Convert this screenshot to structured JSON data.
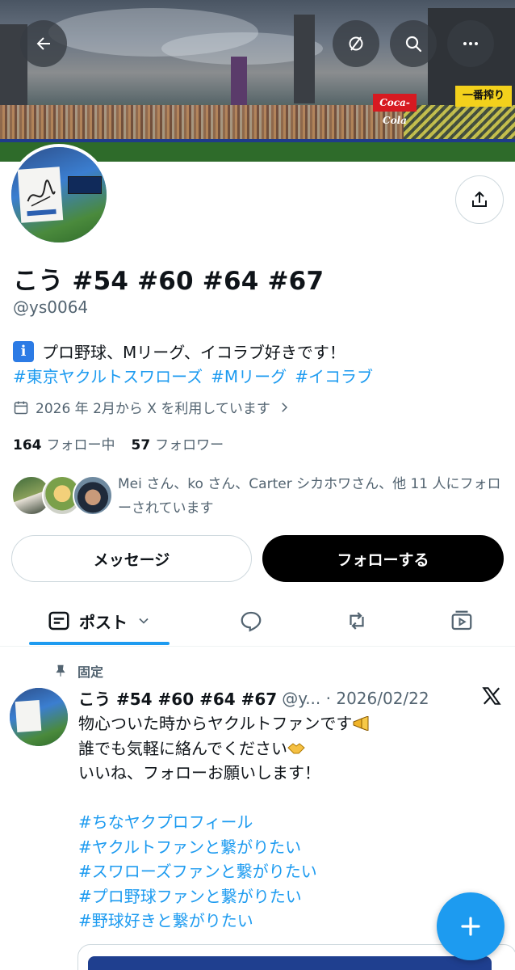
{
  "header": {
    "back_icon": "arrow-left-icon",
    "grok_icon": "slash-circle-icon",
    "search_icon": "search-icon",
    "more_icon": "ellipsis-icon",
    "banner_signs": {
      "coke": "Coca-Cola",
      "yellow": "一番搾り"
    }
  },
  "profile": {
    "display_name": "こう #54 #60 #64 #67",
    "handle": "@ys0064",
    "bio_line1": "プロ野球、Mリーグ、イコラブ好きです！",
    "bio_hashtags": [
      "#東京ヤクルトスワローズ",
      "#Mリーグ",
      "#イコラブ"
    ],
    "joined": "2026 年 2月から X を利用しています",
    "following_count": "164",
    "following_label": "フォロー中",
    "followers_count": "57",
    "followers_label": "フォロワー",
    "followed_by": "Mei さん、ko さん、Carter シカホワさん、他 11 人にフォローされています"
  },
  "actions": {
    "message_label": "メッセージ",
    "follow_label": "フォローする"
  },
  "tabs": {
    "posts_label": "ポスト",
    "icons": [
      "post-list-icon",
      "reply-bubble-icon",
      "retweet-icon",
      "media-icon"
    ]
  },
  "pinned_post": {
    "pinned_label": "固定",
    "author": "こう #54 #60 #64 #67",
    "meta": "@y... · 2026/02/22",
    "lines": [
      "物心ついた時からヤクルトファンです",
      "誰でも気軽に絡んでください",
      "いいね、フォローお願いします！"
    ],
    "hashtags": [
      "#ちなヤクプロフィール",
      "#ヤクルトファンと繋がりたい",
      "#スワローズファンと繋がりたい",
      "#プロ野球ファンと繋がりたい",
      "#野球好きと繋がりたい"
    ]
  },
  "colors": {
    "accent": "#1d9bf0",
    "text": "#0f1419",
    "secondary": "#536471",
    "border": "#cfd9de"
  }
}
